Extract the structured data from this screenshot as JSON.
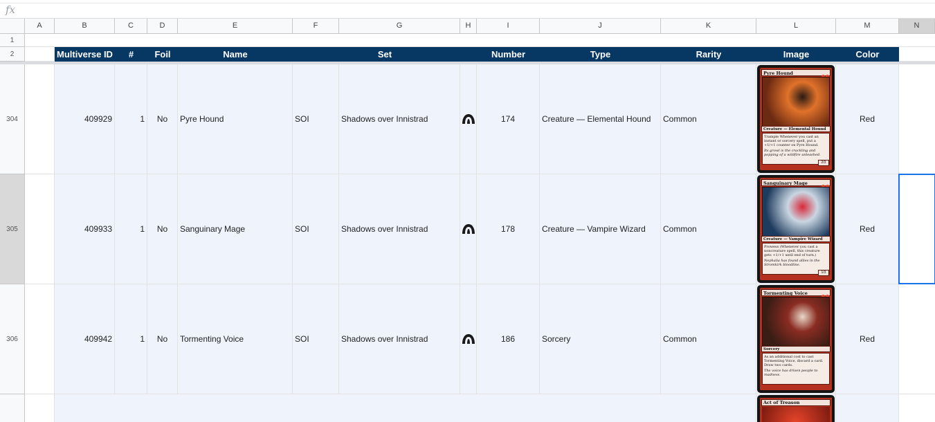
{
  "formula_bar": {
    "fx_label": "fx",
    "value": ""
  },
  "column_headers": [
    "A",
    "B",
    "C",
    "D",
    "E",
    "F",
    "G",
    "H",
    "I",
    "J",
    "K",
    "L",
    "M",
    "N"
  ],
  "row_headers": [
    "1",
    "2",
    "304",
    "305",
    "306"
  ],
  "header_row": {
    "multiverse_id": "Multiverse ID",
    "count": "#",
    "foil": "Foil",
    "name": "Name",
    "set": "Set",
    "number": "Number",
    "type": "Type",
    "rarity": "Rarity",
    "image": "Image",
    "color": "Color"
  },
  "rows": [
    {
      "multiverse_id": "409929",
      "count": "1",
      "foil": "No",
      "name": "Pyre Hound",
      "set_code": "SOI",
      "set_name": "Shadows over Innistrad",
      "number": "174",
      "type": "Creature — Elemental Hound",
      "rarity": "Common",
      "color": "Red",
      "card": {
        "title": "Pyre Hound",
        "type_line": "Creature — Elemental Hound",
        "text": "Trample Whenever you cast an instant or sorcery spell, put a +1/+1 counter on Pyre Hound.",
        "flavor": "Its growl is the crackling and popping of a wildfire unleashed.",
        "pt": "2/3",
        "art_colors": [
          "#6b2a12",
          "#e0722a",
          "#2b1a14"
        ]
      }
    },
    {
      "multiverse_id": "409933",
      "count": "1",
      "foil": "No",
      "name": "Sanguinary Mage",
      "set_code": "SOI",
      "set_name": "Shadows over Innistrad",
      "number": "178",
      "type": "Creature — Vampire Wizard",
      "rarity": "Common",
      "color": "Red",
      "card": {
        "title": "Sanguinary Mage",
        "type_line": "Creature — Vampire Wizard",
        "text": "Prowess (Whenever you cast a noncreature spell, this creature gets +1/+1 until end of turn.)",
        "flavor": "Nephalia has found allies in the Stromkirk bloodline.",
        "pt": "1/3",
        "art_colors": [
          "#1d3b5e",
          "#c9d6e2",
          "#d92a3a"
        ]
      }
    },
    {
      "multiverse_id": "409942",
      "count": "1",
      "foil": "No",
      "name": "Tormenting Voice",
      "set_code": "SOI",
      "set_name": "Shadows over Innistrad",
      "number": "186",
      "type": "Sorcery",
      "rarity": "Common",
      "color": "Red",
      "card": {
        "title": "Tormenting Voice",
        "type_line": "Sorcery",
        "text": "As an additional cost to cast Tormenting Voice, discard a card. Draw two cards.",
        "flavor": "The voice has driven people to madness.",
        "pt": "",
        "art_colors": [
          "#3a1d14",
          "#8a2c22",
          "#e8d8c8"
        ]
      }
    }
  ],
  "partial_row": {
    "card_title": "Act of Treason"
  }
}
